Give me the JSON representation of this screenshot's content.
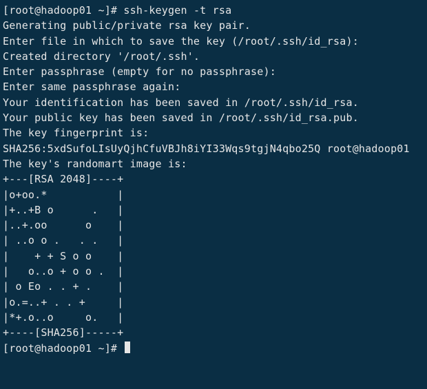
{
  "prompt1": {
    "open": "[",
    "user": "root@hadoop01",
    "path": " ~",
    "close": "]# ",
    "command": "ssh-keygen -t rsa"
  },
  "lines": {
    "l1": "Generating public/private rsa key pair.",
    "l2": "Enter file in which to save the key (/root/.ssh/id_rsa):",
    "l3": "Created directory '/root/.ssh'.",
    "l4": "Enter passphrase (empty for no passphrase):",
    "l5": "Enter same passphrase again:",
    "l6": "Your identification has been saved in /root/.ssh/id_rsa.",
    "l7": "Your public key has been saved in /root/.ssh/id_rsa.pub.",
    "l8": "The key fingerprint is:",
    "l9": "SHA256:5xdSufoLIsUyQjhCfuVBJh8iYI33Wqs9tgjN4qbo25Q root@hadoop01",
    "l10": "The key's randomart image is:",
    "art1": "+---[RSA 2048]----+",
    "art2": "|o+oo.*           |",
    "art3": "|+..+B o      .   |",
    "art4": "|..+.oo      o    |",
    "art5": "| ..o o .   . .   |",
    "art6": "|    + + S o o    |",
    "art7": "|   o..o + o o .  |",
    "art8": "| o Eo . . + .    |",
    "art9": "|o.=..+ . . +     |",
    "art10": "|*+.o..o     o.   |",
    "art11": "+----[SHA256]-----+"
  },
  "prompt2": {
    "open": "[",
    "user": "root@hadoop01",
    "path": " ~",
    "close": "]# "
  }
}
